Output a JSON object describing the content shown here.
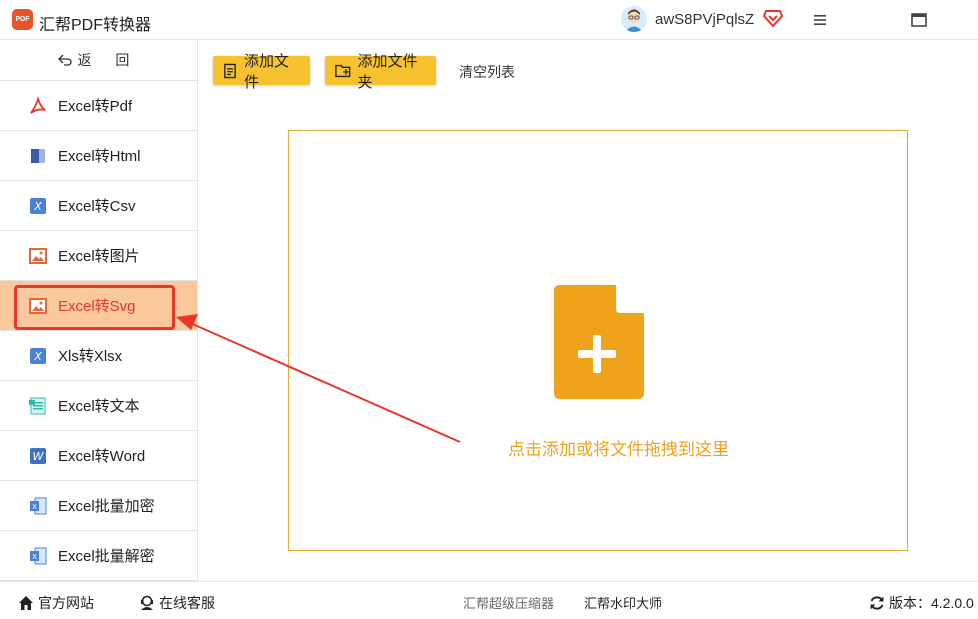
{
  "app": {
    "logo_text": "PDF",
    "title": "汇帮PDF转换器",
    "username": "awS8PVjPqlsZ"
  },
  "sidebar": {
    "back_label": "返 回",
    "items": [
      {
        "label": "Excel转Pdf",
        "icon": "pdf-icon"
      },
      {
        "label": "Excel转Html",
        "icon": "html-icon"
      },
      {
        "label": "Excel转Csv",
        "icon": "csv-icon"
      },
      {
        "label": "Excel转图片",
        "icon": "image-icon"
      },
      {
        "label": "Excel转Svg",
        "icon": "svg-image-icon",
        "active": true
      },
      {
        "label": "Xls转Xlsx",
        "icon": "xlsx-icon"
      },
      {
        "label": "Excel转文本",
        "icon": "text-icon"
      },
      {
        "label": "Excel转Word",
        "icon": "word-icon"
      },
      {
        "label": "Excel批量加密",
        "icon": "excel-icon"
      },
      {
        "label": "Excel批量解密",
        "icon": "excel-icon"
      }
    ]
  },
  "toolbar": {
    "add_file": "添加文件",
    "add_folder": "添加文件夹",
    "clear_list": "清空列表"
  },
  "dropzone": {
    "hint": "点击添加或将文件拖拽到这里"
  },
  "footer": {
    "website": "官方网站",
    "support": "在线客服",
    "compressor": "汇帮超级压缩器",
    "watermark": "汇帮水印大师",
    "version_label": "版本：",
    "version": "4.2.0.0"
  },
  "colors": {
    "accent_yellow": "#f7c22f",
    "active_bg": "#f9c89d",
    "active_text": "#e8372a",
    "drop_border": "#e0a93a",
    "hint": "#f0a21c"
  }
}
